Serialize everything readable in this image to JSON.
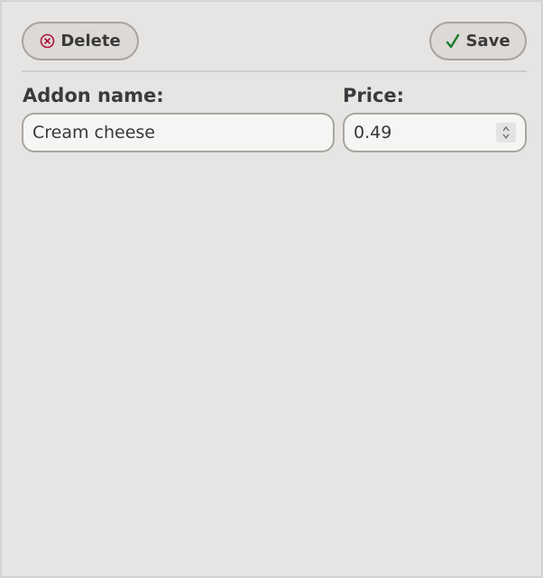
{
  "toolbar": {
    "delete_label": "Delete",
    "save_label": "Save",
    "delete_icon": "circle-x-icon",
    "save_icon": "checkmark-icon",
    "delete_icon_color": "#b0133a",
    "save_icon_color": "#1a7a2e"
  },
  "form": {
    "name_label": "Addon name:",
    "name_value": "Cream cheese",
    "price_label": "Price:",
    "price_value": "0.49"
  }
}
